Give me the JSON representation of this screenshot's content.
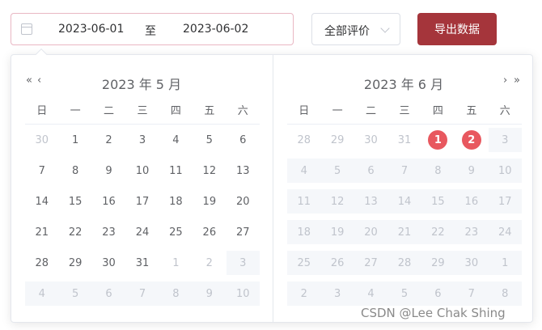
{
  "range": {
    "start": "2023-06-01",
    "separator": "至",
    "end": "2023-06-02"
  },
  "filter": {
    "selected": "全部评价"
  },
  "export_label": "导出数据",
  "weekdays": [
    "日",
    "一",
    "二",
    "三",
    "四",
    "五",
    "六"
  ],
  "nav": {
    "prev_year": "«",
    "prev_month": "‹",
    "next_month": "›",
    "next_year": "»"
  },
  "calendars": [
    {
      "title": "2023 年 5 月",
      "rows": [
        [
          {
            "d": "30",
            "t": "other"
          },
          {
            "d": "1",
            "t": "cur"
          },
          {
            "d": "2",
            "t": "cur"
          },
          {
            "d": "3",
            "t": "cur"
          },
          {
            "d": "4",
            "t": "cur"
          },
          {
            "d": "5",
            "t": "cur"
          },
          {
            "d": "6",
            "t": "cur"
          }
        ],
        [
          {
            "d": "7",
            "t": "cur"
          },
          {
            "d": "8",
            "t": "cur"
          },
          {
            "d": "9",
            "t": "cur"
          },
          {
            "d": "10",
            "t": "cur"
          },
          {
            "d": "11",
            "t": "cur"
          },
          {
            "d": "12",
            "t": "cur"
          },
          {
            "d": "13",
            "t": "cur"
          }
        ],
        [
          {
            "d": "14",
            "t": "cur"
          },
          {
            "d": "15",
            "t": "cur"
          },
          {
            "d": "16",
            "t": "cur"
          },
          {
            "d": "17",
            "t": "cur"
          },
          {
            "d": "18",
            "t": "cur"
          },
          {
            "d": "19",
            "t": "cur"
          },
          {
            "d": "20",
            "t": "cur"
          }
        ],
        [
          {
            "d": "21",
            "t": "cur"
          },
          {
            "d": "22",
            "t": "cur"
          },
          {
            "d": "23",
            "t": "cur"
          },
          {
            "d": "24",
            "t": "cur"
          },
          {
            "d": "25",
            "t": "cur"
          },
          {
            "d": "26",
            "t": "cur"
          },
          {
            "d": "27",
            "t": "cur"
          }
        ],
        [
          {
            "d": "28",
            "t": "cur"
          },
          {
            "d": "29",
            "t": "cur"
          },
          {
            "d": "30",
            "t": "cur"
          },
          {
            "d": "31",
            "t": "cur"
          },
          {
            "d": "1",
            "t": "other"
          },
          {
            "d": "2",
            "t": "other"
          },
          {
            "d": "3",
            "t": "disabled"
          }
        ],
        [
          {
            "d": "4",
            "t": "disabled"
          },
          {
            "d": "5",
            "t": "disabled"
          },
          {
            "d": "6",
            "t": "disabled"
          },
          {
            "d": "7",
            "t": "disabled"
          },
          {
            "d": "8",
            "t": "disabled"
          },
          {
            "d": "9",
            "t": "disabled"
          },
          {
            "d": "10",
            "t": "disabled"
          }
        ]
      ]
    },
    {
      "title": "2023 年 6 月",
      "rows": [
        [
          {
            "d": "28",
            "t": "other"
          },
          {
            "d": "29",
            "t": "other"
          },
          {
            "d": "30",
            "t": "other"
          },
          {
            "d": "31",
            "t": "other"
          },
          {
            "d": "1",
            "t": "selected"
          },
          {
            "d": "2",
            "t": "selected"
          },
          {
            "d": "3",
            "t": "disabled"
          }
        ],
        [
          {
            "d": "4",
            "t": "disabled"
          },
          {
            "d": "5",
            "t": "disabled"
          },
          {
            "d": "6",
            "t": "disabled"
          },
          {
            "d": "7",
            "t": "disabled"
          },
          {
            "d": "8",
            "t": "disabled"
          },
          {
            "d": "9",
            "t": "disabled"
          },
          {
            "d": "10",
            "t": "disabled"
          }
        ],
        [
          {
            "d": "11",
            "t": "disabled"
          },
          {
            "d": "12",
            "t": "disabled"
          },
          {
            "d": "13",
            "t": "disabled"
          },
          {
            "d": "14",
            "t": "disabled"
          },
          {
            "d": "15",
            "t": "disabled"
          },
          {
            "d": "16",
            "t": "disabled"
          },
          {
            "d": "17",
            "t": "disabled"
          }
        ],
        [
          {
            "d": "18",
            "t": "disabled"
          },
          {
            "d": "19",
            "t": "disabled"
          },
          {
            "d": "20",
            "t": "disabled"
          },
          {
            "d": "21",
            "t": "disabled"
          },
          {
            "d": "22",
            "t": "disabled"
          },
          {
            "d": "23",
            "t": "disabled"
          },
          {
            "d": "24",
            "t": "disabled"
          }
        ],
        [
          {
            "d": "25",
            "t": "disabled"
          },
          {
            "d": "26",
            "t": "disabled"
          },
          {
            "d": "27",
            "t": "disabled"
          },
          {
            "d": "28",
            "t": "disabled"
          },
          {
            "d": "29",
            "t": "disabled"
          },
          {
            "d": "30",
            "t": "disabled"
          },
          {
            "d": "1",
            "t": "disabled"
          }
        ],
        [
          {
            "d": "2",
            "t": "disabled"
          },
          {
            "d": "3",
            "t": "disabled"
          },
          {
            "d": "4",
            "t": "disabled"
          },
          {
            "d": "5",
            "t": "disabled"
          },
          {
            "d": "6",
            "t": "disabled"
          },
          {
            "d": "7",
            "t": "disabled"
          },
          {
            "d": "8",
            "t": "disabled"
          }
        ]
      ]
    }
  ],
  "watermark": "CSDN @Lee Chak Shing",
  "colors": {
    "accent": "#a5353b",
    "selected": "#e8585f",
    "disabled_bg": "#f5f7fa"
  }
}
